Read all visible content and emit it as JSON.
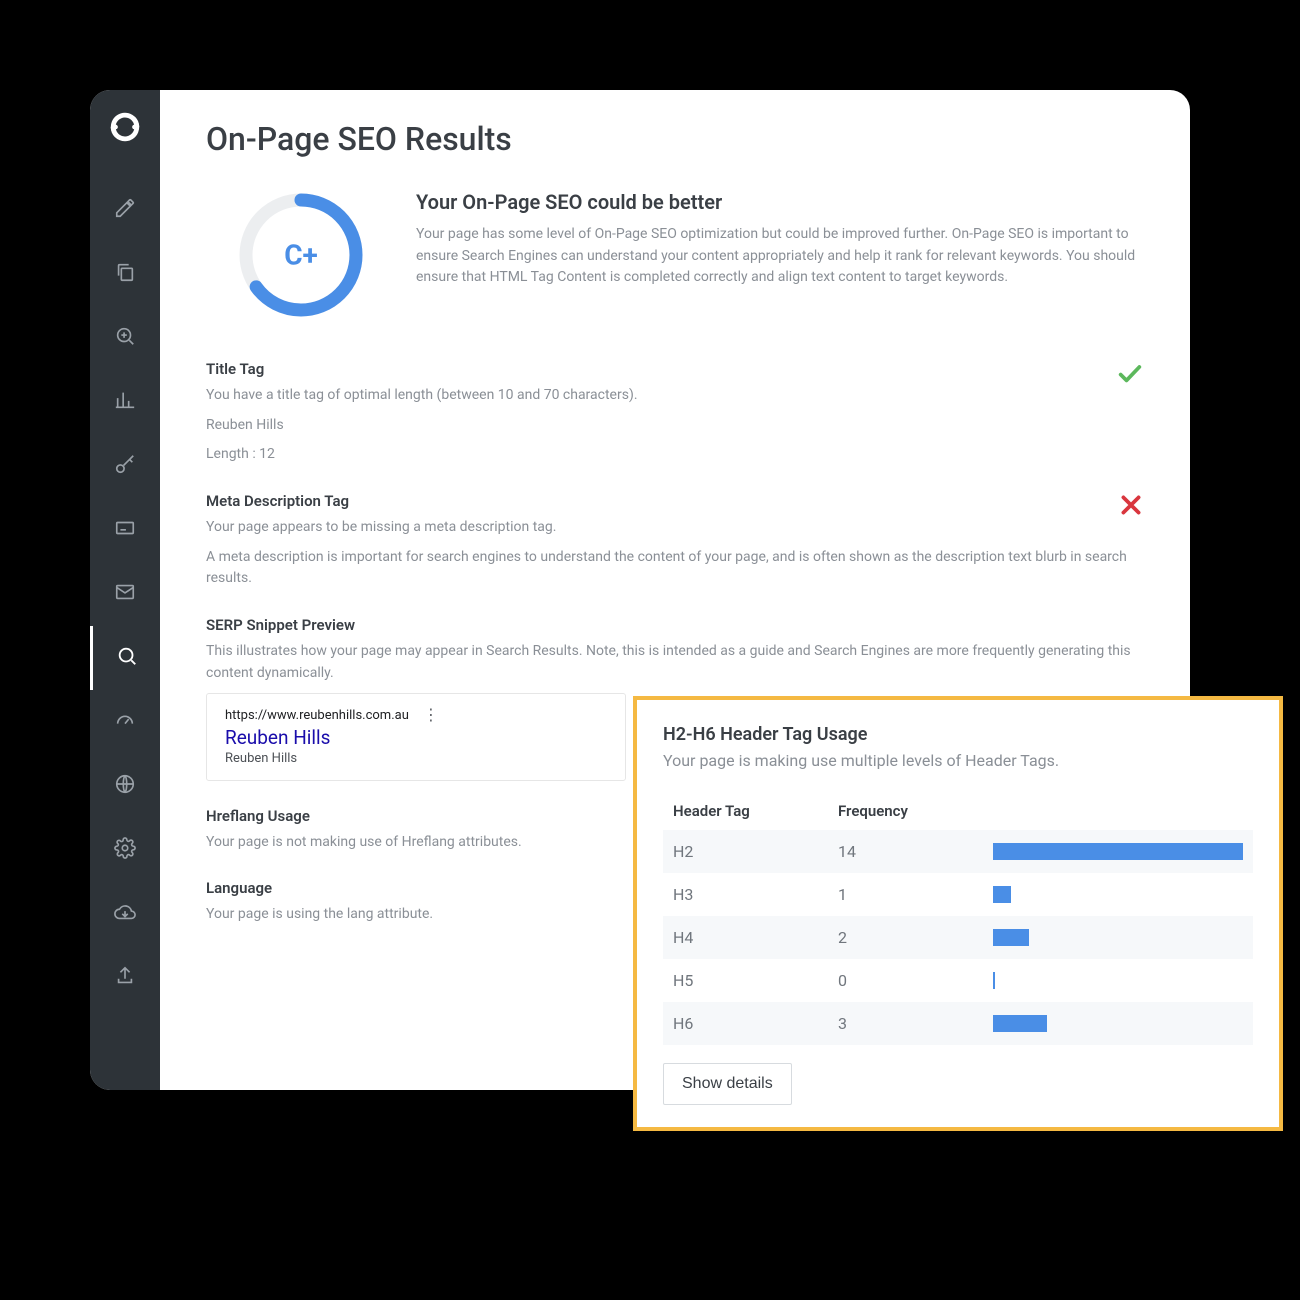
{
  "page_title": "On-Page SEO Results",
  "score": {
    "grade": "C+",
    "heading": "Your On-Page SEO could be better",
    "description": "Your page has some level of On-Page SEO optimization but could be improved further. On-Page SEO is important to ensure Search Engines can understand your content appropriately and help it rank for relevant keywords. You should ensure that HTML Tag Content is completed correctly and align text content to target keywords."
  },
  "title_tag": {
    "label": "Title Tag",
    "desc": "You have a title tag of optimal length (between 10 and 70 characters).",
    "value": "Reuben Hills",
    "length": "Length : 12"
  },
  "meta_desc": {
    "label": "Meta Description Tag",
    "desc": "Your page appears to be missing a meta description tag.",
    "extra": "A meta description is important for search engines to understand the content of your page, and is often shown as the description text blurb in search results."
  },
  "serp": {
    "label": "SERP Snippet Preview",
    "desc": "This illustrates how your page may appear in Search Results. Note, this is intended as a guide and Search Engines are more frequently generating this content dynamically.",
    "url": "https://www.reubenhills.com.au",
    "title": "Reuben Hills",
    "snippet": "Reuben Hills"
  },
  "hreflang": {
    "label": "Hreflang Usage",
    "desc": "Your page is not making use of Hreflang attributes."
  },
  "language": {
    "label": "Language",
    "desc": "Your page is using the lang attribute."
  },
  "header_usage": {
    "title": "H2-H6 Header Tag Usage",
    "desc": "Your page is making use multiple levels of Header Tags.",
    "col_tag": "Header Tag",
    "col_freq": "Frequency",
    "rows": [
      {
        "tag": "H2",
        "freq": "14"
      },
      {
        "tag": "H3",
        "freq": "1"
      },
      {
        "tag": "H4",
        "freq": "2"
      },
      {
        "tag": "H5",
        "freq": "0"
      },
      {
        "tag": "H6",
        "freq": "3"
      }
    ],
    "button": "Show details"
  },
  "chart_data": {
    "type": "bar",
    "categories": [
      "H2",
      "H3",
      "H4",
      "H5",
      "H6"
    ],
    "values": [
      14,
      1,
      2,
      0,
      3
    ],
    "title": "H2-H6 Header Tag Usage",
    "xlabel": "Header Tag",
    "ylabel": "Frequency",
    "ylim": [
      0,
      14
    ]
  }
}
